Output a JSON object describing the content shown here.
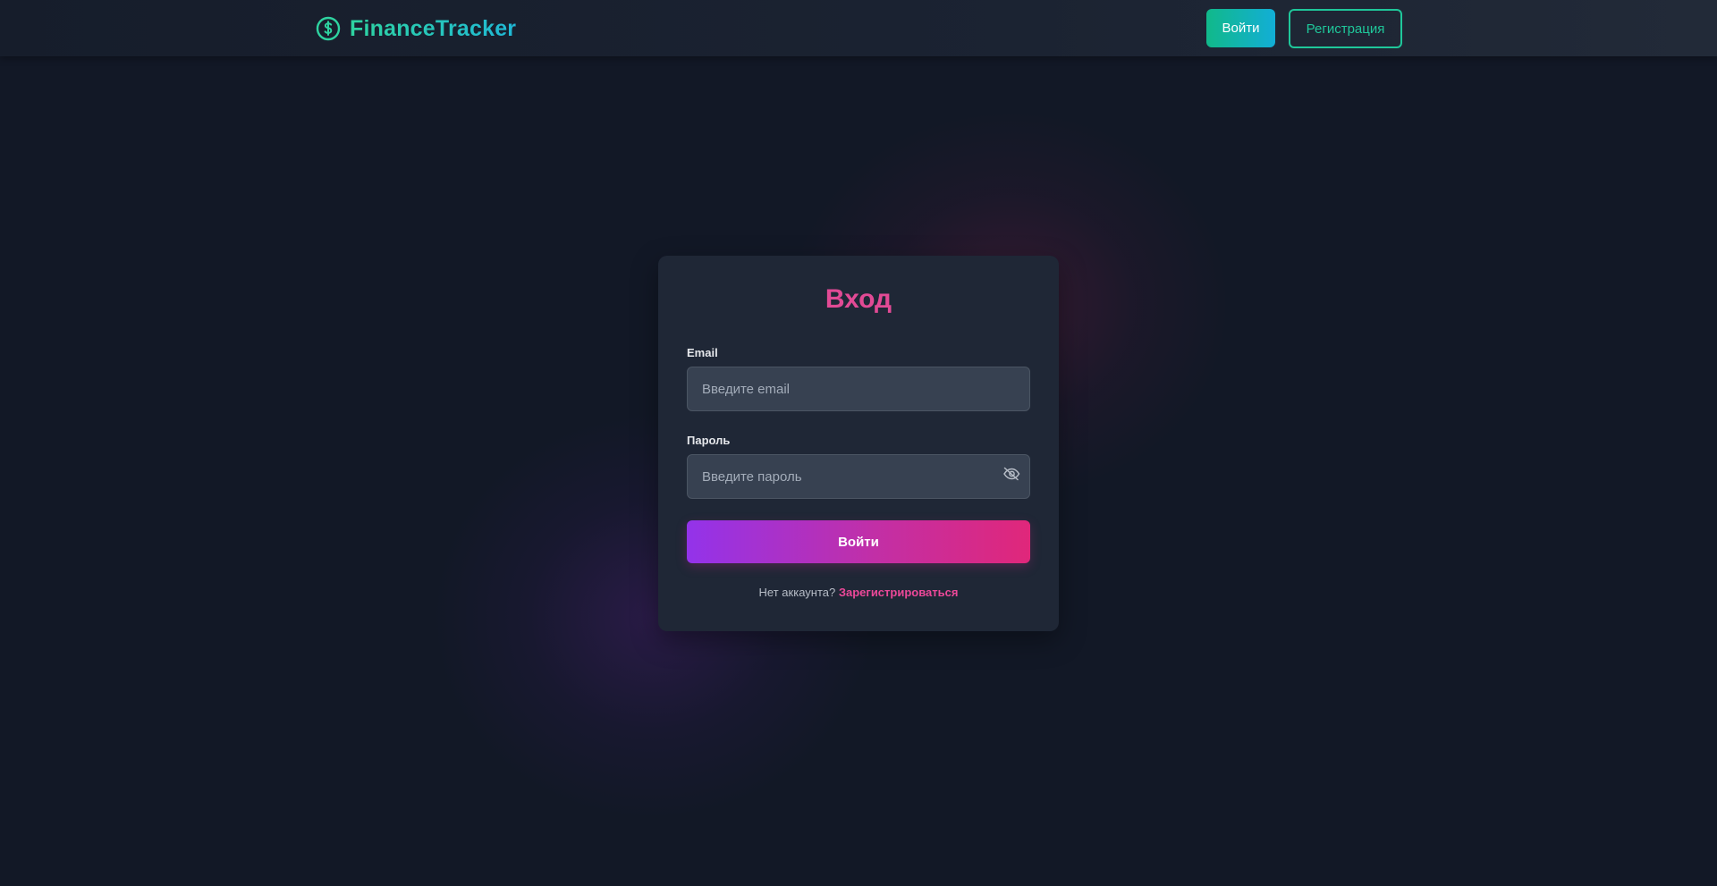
{
  "header": {
    "brand_name": "FinanceTracker",
    "brand_icon": "dollar-circle-icon",
    "login_label": "Войти",
    "register_label": "Регистрация"
  },
  "login_form": {
    "title": "Вход",
    "email_label": "Email",
    "email_placeholder": "Введите email",
    "email_value": "",
    "password_label": "Пароль",
    "password_placeholder": "Введите пароль",
    "password_value": "",
    "password_toggle_icon": "eye-off-icon",
    "submit_label": "Войти",
    "no_account_text": "Нет аккаунта?",
    "register_link": "Зарегистрироваться"
  },
  "colors": {
    "background": "#121826",
    "card": "#1f2736",
    "brand_accent": "#2ed3a0",
    "title_accent": "#e24a95",
    "link_accent": "#ec4899",
    "button_gradient_start": "#9333ea",
    "button_gradient_end": "#e0277a"
  }
}
